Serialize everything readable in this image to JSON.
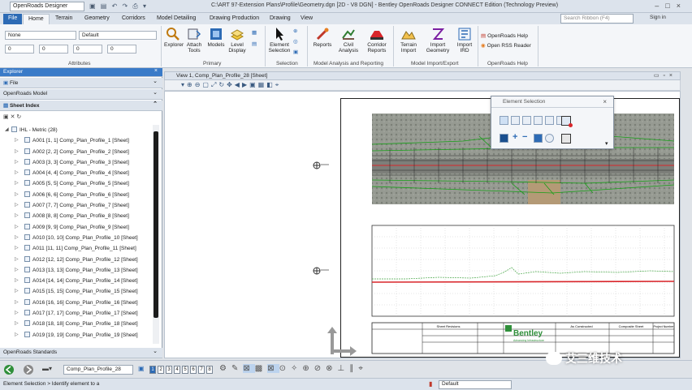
{
  "titlebar": {
    "workspace": "OpenRoads Designer",
    "title": "C:\\ART 97-Extension Plans\\Profile\\Geometry.dgn [2D - V8 DGN] - Bentley OpenRoads Designer CONNECT Edition (Technology Preview)",
    "min": "–",
    "max": "□",
    "close": "×"
  },
  "tabs": [
    "File",
    "Home",
    "Terrain",
    "Geometry",
    "Corridors",
    "Model Detailing",
    "Drawing Production",
    "Drawing",
    "View"
  ],
  "search_placeholder": "Search Ribbon (F4)",
  "signin": "Sign in",
  "ribbon": {
    "attributes": {
      "level": "None",
      "style": "Default",
      "color_val": "0",
      "weight_val": "0",
      "line_val": "0",
      "trans_val": "0",
      "label": "Attributes"
    },
    "primary": {
      "buttons": [
        "Explorer",
        "Attach Tools",
        "Models",
        "Level Display"
      ],
      "label": "Primary"
    },
    "selection": {
      "button": "Element Selection",
      "label": "Selection"
    },
    "analysis": {
      "buttons": [
        "Reports",
        "Civil Analysis",
        "Corridor Reports"
      ],
      "label": "Model Analysis and Reporting"
    },
    "import": {
      "buttons": [
        "Terrain Import",
        "Import Geometry",
        "Import IRD"
      ],
      "label": "Model Import/Export"
    },
    "help": {
      "items": [
        "OpenRoads Help",
        "Open RSS Reader"
      ],
      "label": "OpenRoads Help"
    }
  },
  "explorer": {
    "title": "Explorer",
    "sections": [
      "File",
      "OpenRoads Model",
      "Sheet Index"
    ],
    "root": "IHL - Metric (28)",
    "items": [
      "A001 [1, 1] Comp_Plan_Profile_1 [Sheet]",
      "A002 [2, 2] Comp_Plan_Profile_2 [Sheet]",
      "A003 [3, 3] Comp_Plan_Profile_3 [Sheet]",
      "A004 [4, 4] Comp_Plan_Profile_4 [Sheet]",
      "A005 [5, 5] Comp_Plan_Profile_5 [Sheet]",
      "A006 [6, 6] Comp_Plan_Profile_6 [Sheet]",
      "A007 [7, 7] Comp_Plan_Profile_7 [Sheet]",
      "A008 [8, 8] Comp_Plan_Profile_8 [Sheet]",
      "A009 [9, 9] Comp_Plan_Profile_9 [Sheet]",
      "A010 [10, 10] Comp_Plan_Profile_10 [Sheet]",
      "A011 [11, 11] Comp_Plan_Profile_11 [Sheet]",
      "A012 [12, 12] Comp_Plan_Profile_12 [Sheet]",
      "A013 [13, 13] Comp_Plan_Profile_13 [Sheet]",
      "A014 [14, 14] Comp_Plan_Profile_14 [Sheet]",
      "A015 [15, 15] Comp_Plan_Profile_15 [Sheet]",
      "A016 [16, 16] Comp_Plan_Profile_16 [Sheet]",
      "A017 [17, 17] Comp_Plan_Profile_17 [Sheet]",
      "A018 [18, 18] Comp_Plan_Profile_18 [Sheet]",
      "A019 [19, 19] Comp_Plan_Profile_19 [Sheet]"
    ],
    "footer": "OpenRoads Standards"
  },
  "view": {
    "title": "View 1, Comp_Plan_Profile_28 [Sheet]"
  },
  "element_selection": {
    "title": "Element Selection"
  },
  "sheet": {
    "title_block": [
      "Sheet Revisions",
      "As Constructed",
      "Composite Sheet",
      "Project Number"
    ],
    "logo": "Bentley",
    "logo_sub": "Advancing Infrastructure"
  },
  "bottom": {
    "view_combo": "Comp_Plan_Profile_28",
    "view_numbers": [
      "1",
      "2",
      "3",
      "4",
      "5",
      "6",
      "7",
      "8"
    ]
  },
  "status": {
    "prompt": "Element Selection > Identify element to a",
    "level": "Default"
  },
  "watermark": "艾三维技术",
  "colors": {
    "accent": "#2d6bb5",
    "profile_red": "#d9252a",
    "corridor_green": "#1aa51a"
  }
}
